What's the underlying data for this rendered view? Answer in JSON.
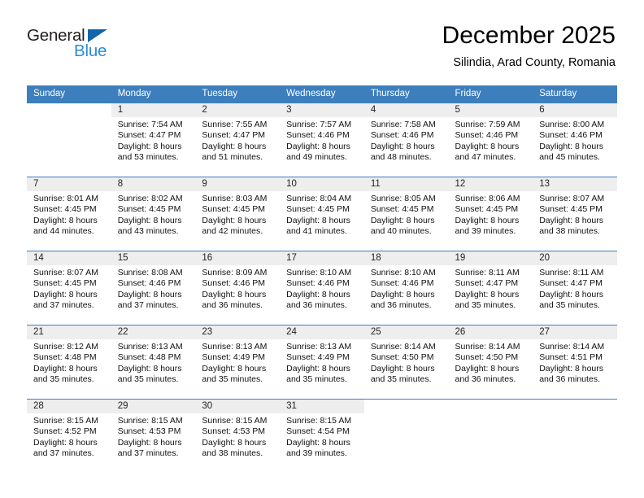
{
  "brand": {
    "name_dark": "General",
    "name_blue": "Blue",
    "accent_dark": "#231f20",
    "accent_blue": "#2e8bd4",
    "triangle_color": "#1464aa"
  },
  "header": {
    "title": "December 2025",
    "subtitle": "Silindia, Arad County, Romania"
  },
  "colors": {
    "header_row_bg": "#3d7ebd",
    "header_row_text": "#ffffff",
    "daynum_band_bg": "#eeeeee",
    "cell_bg": "#ffffff",
    "separator": "#3d7ebd"
  },
  "weekdays": [
    "Sunday",
    "Monday",
    "Tuesday",
    "Wednesday",
    "Thursday",
    "Friday",
    "Saturday"
  ],
  "weeks": [
    [
      {
        "day": "",
        "sunrise": "",
        "sunset": "",
        "daylight1": "",
        "daylight2": "",
        "blank": true
      },
      {
        "day": "1",
        "sunrise": "Sunrise: 7:54 AM",
        "sunset": "Sunset: 4:47 PM",
        "daylight1": "Daylight: 8 hours",
        "daylight2": "and 53 minutes."
      },
      {
        "day": "2",
        "sunrise": "Sunrise: 7:55 AM",
        "sunset": "Sunset: 4:47 PM",
        "daylight1": "Daylight: 8 hours",
        "daylight2": "and 51 minutes."
      },
      {
        "day": "3",
        "sunrise": "Sunrise: 7:57 AM",
        "sunset": "Sunset: 4:46 PM",
        "daylight1": "Daylight: 8 hours",
        "daylight2": "and 49 minutes."
      },
      {
        "day": "4",
        "sunrise": "Sunrise: 7:58 AM",
        "sunset": "Sunset: 4:46 PM",
        "daylight1": "Daylight: 8 hours",
        "daylight2": "and 48 minutes."
      },
      {
        "day": "5",
        "sunrise": "Sunrise: 7:59 AM",
        "sunset": "Sunset: 4:46 PM",
        "daylight1": "Daylight: 8 hours",
        "daylight2": "and 47 minutes."
      },
      {
        "day": "6",
        "sunrise": "Sunrise: 8:00 AM",
        "sunset": "Sunset: 4:46 PM",
        "daylight1": "Daylight: 8 hours",
        "daylight2": "and 45 minutes."
      }
    ],
    [
      {
        "day": "7",
        "sunrise": "Sunrise: 8:01 AM",
        "sunset": "Sunset: 4:45 PM",
        "daylight1": "Daylight: 8 hours",
        "daylight2": "and 44 minutes."
      },
      {
        "day": "8",
        "sunrise": "Sunrise: 8:02 AM",
        "sunset": "Sunset: 4:45 PM",
        "daylight1": "Daylight: 8 hours",
        "daylight2": "and 43 minutes."
      },
      {
        "day": "9",
        "sunrise": "Sunrise: 8:03 AM",
        "sunset": "Sunset: 4:45 PM",
        "daylight1": "Daylight: 8 hours",
        "daylight2": "and 42 minutes."
      },
      {
        "day": "10",
        "sunrise": "Sunrise: 8:04 AM",
        "sunset": "Sunset: 4:45 PM",
        "daylight1": "Daylight: 8 hours",
        "daylight2": "and 41 minutes."
      },
      {
        "day": "11",
        "sunrise": "Sunrise: 8:05 AM",
        "sunset": "Sunset: 4:45 PM",
        "daylight1": "Daylight: 8 hours",
        "daylight2": "and 40 minutes."
      },
      {
        "day": "12",
        "sunrise": "Sunrise: 8:06 AM",
        "sunset": "Sunset: 4:45 PM",
        "daylight1": "Daylight: 8 hours",
        "daylight2": "and 39 minutes."
      },
      {
        "day": "13",
        "sunrise": "Sunrise: 8:07 AM",
        "sunset": "Sunset: 4:45 PM",
        "daylight1": "Daylight: 8 hours",
        "daylight2": "and 38 minutes."
      }
    ],
    [
      {
        "day": "14",
        "sunrise": "Sunrise: 8:07 AM",
        "sunset": "Sunset: 4:45 PM",
        "daylight1": "Daylight: 8 hours",
        "daylight2": "and 37 minutes."
      },
      {
        "day": "15",
        "sunrise": "Sunrise: 8:08 AM",
        "sunset": "Sunset: 4:46 PM",
        "daylight1": "Daylight: 8 hours",
        "daylight2": "and 37 minutes."
      },
      {
        "day": "16",
        "sunrise": "Sunrise: 8:09 AM",
        "sunset": "Sunset: 4:46 PM",
        "daylight1": "Daylight: 8 hours",
        "daylight2": "and 36 minutes."
      },
      {
        "day": "17",
        "sunrise": "Sunrise: 8:10 AM",
        "sunset": "Sunset: 4:46 PM",
        "daylight1": "Daylight: 8 hours",
        "daylight2": "and 36 minutes."
      },
      {
        "day": "18",
        "sunrise": "Sunrise: 8:10 AM",
        "sunset": "Sunset: 4:46 PM",
        "daylight1": "Daylight: 8 hours",
        "daylight2": "and 36 minutes."
      },
      {
        "day": "19",
        "sunrise": "Sunrise: 8:11 AM",
        "sunset": "Sunset: 4:47 PM",
        "daylight1": "Daylight: 8 hours",
        "daylight2": "and 35 minutes."
      },
      {
        "day": "20",
        "sunrise": "Sunrise: 8:11 AM",
        "sunset": "Sunset: 4:47 PM",
        "daylight1": "Daylight: 8 hours",
        "daylight2": "and 35 minutes."
      }
    ],
    [
      {
        "day": "21",
        "sunrise": "Sunrise: 8:12 AM",
        "sunset": "Sunset: 4:48 PM",
        "daylight1": "Daylight: 8 hours",
        "daylight2": "and 35 minutes."
      },
      {
        "day": "22",
        "sunrise": "Sunrise: 8:13 AM",
        "sunset": "Sunset: 4:48 PM",
        "daylight1": "Daylight: 8 hours",
        "daylight2": "and 35 minutes."
      },
      {
        "day": "23",
        "sunrise": "Sunrise: 8:13 AM",
        "sunset": "Sunset: 4:49 PM",
        "daylight1": "Daylight: 8 hours",
        "daylight2": "and 35 minutes."
      },
      {
        "day": "24",
        "sunrise": "Sunrise: 8:13 AM",
        "sunset": "Sunset: 4:49 PM",
        "daylight1": "Daylight: 8 hours",
        "daylight2": "and 35 minutes."
      },
      {
        "day": "25",
        "sunrise": "Sunrise: 8:14 AM",
        "sunset": "Sunset: 4:50 PM",
        "daylight1": "Daylight: 8 hours",
        "daylight2": "and 35 minutes."
      },
      {
        "day": "26",
        "sunrise": "Sunrise: 8:14 AM",
        "sunset": "Sunset: 4:50 PM",
        "daylight1": "Daylight: 8 hours",
        "daylight2": "and 36 minutes."
      },
      {
        "day": "27",
        "sunrise": "Sunrise: 8:14 AM",
        "sunset": "Sunset: 4:51 PM",
        "daylight1": "Daylight: 8 hours",
        "daylight2": "and 36 minutes."
      }
    ],
    [
      {
        "day": "28",
        "sunrise": "Sunrise: 8:15 AM",
        "sunset": "Sunset: 4:52 PM",
        "daylight1": "Daylight: 8 hours",
        "daylight2": "and 37 minutes."
      },
      {
        "day": "29",
        "sunrise": "Sunrise: 8:15 AM",
        "sunset": "Sunset: 4:53 PM",
        "daylight1": "Daylight: 8 hours",
        "daylight2": "and 37 minutes."
      },
      {
        "day": "30",
        "sunrise": "Sunrise: 8:15 AM",
        "sunset": "Sunset: 4:53 PM",
        "daylight1": "Daylight: 8 hours",
        "daylight2": "and 38 minutes."
      },
      {
        "day": "31",
        "sunrise": "Sunrise: 8:15 AM",
        "sunset": "Sunset: 4:54 PM",
        "daylight1": "Daylight: 8 hours",
        "daylight2": "and 39 minutes."
      },
      {
        "day": "",
        "sunrise": "",
        "sunset": "",
        "daylight1": "",
        "daylight2": "",
        "blank": true
      },
      {
        "day": "",
        "sunrise": "",
        "sunset": "",
        "daylight1": "",
        "daylight2": "",
        "blank": true
      },
      {
        "day": "",
        "sunrise": "",
        "sunset": "",
        "daylight1": "",
        "daylight2": "",
        "blank": true
      }
    ]
  ]
}
